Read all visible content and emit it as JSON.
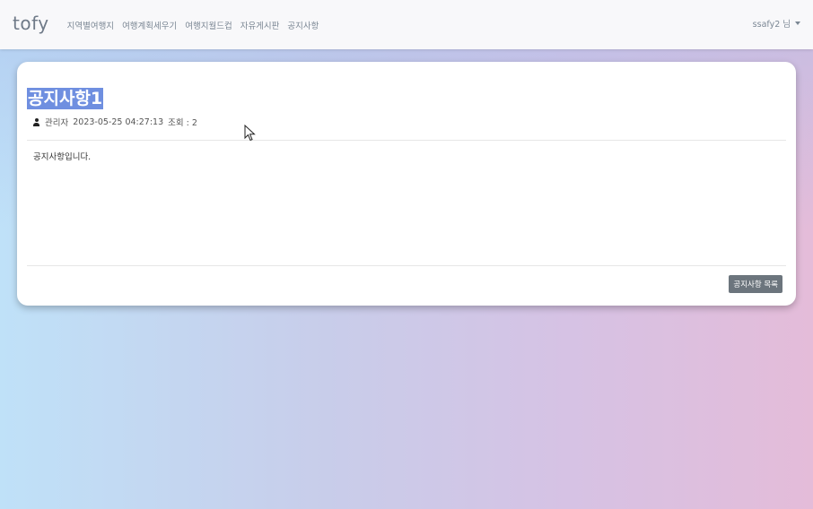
{
  "navbar": {
    "brand": "tofy",
    "links": [
      "지역별여행지",
      "여행계획세우기",
      "여행지월드컵",
      "자유게시판",
      "공지사항"
    ],
    "user": "ssafy2 님"
  },
  "notice": {
    "title": "공지사항1",
    "author": "관리자",
    "date": "2023-05-25 04:27:13",
    "views_label": "조회 : 2",
    "content": "공지사항입니다.",
    "list_button": "공지사항 목록"
  },
  "colors": {
    "selection": "#6f8fe0",
    "button": "#6c757d"
  },
  "icons": {
    "author": "person-icon",
    "user_menu": "caret-down-icon"
  }
}
